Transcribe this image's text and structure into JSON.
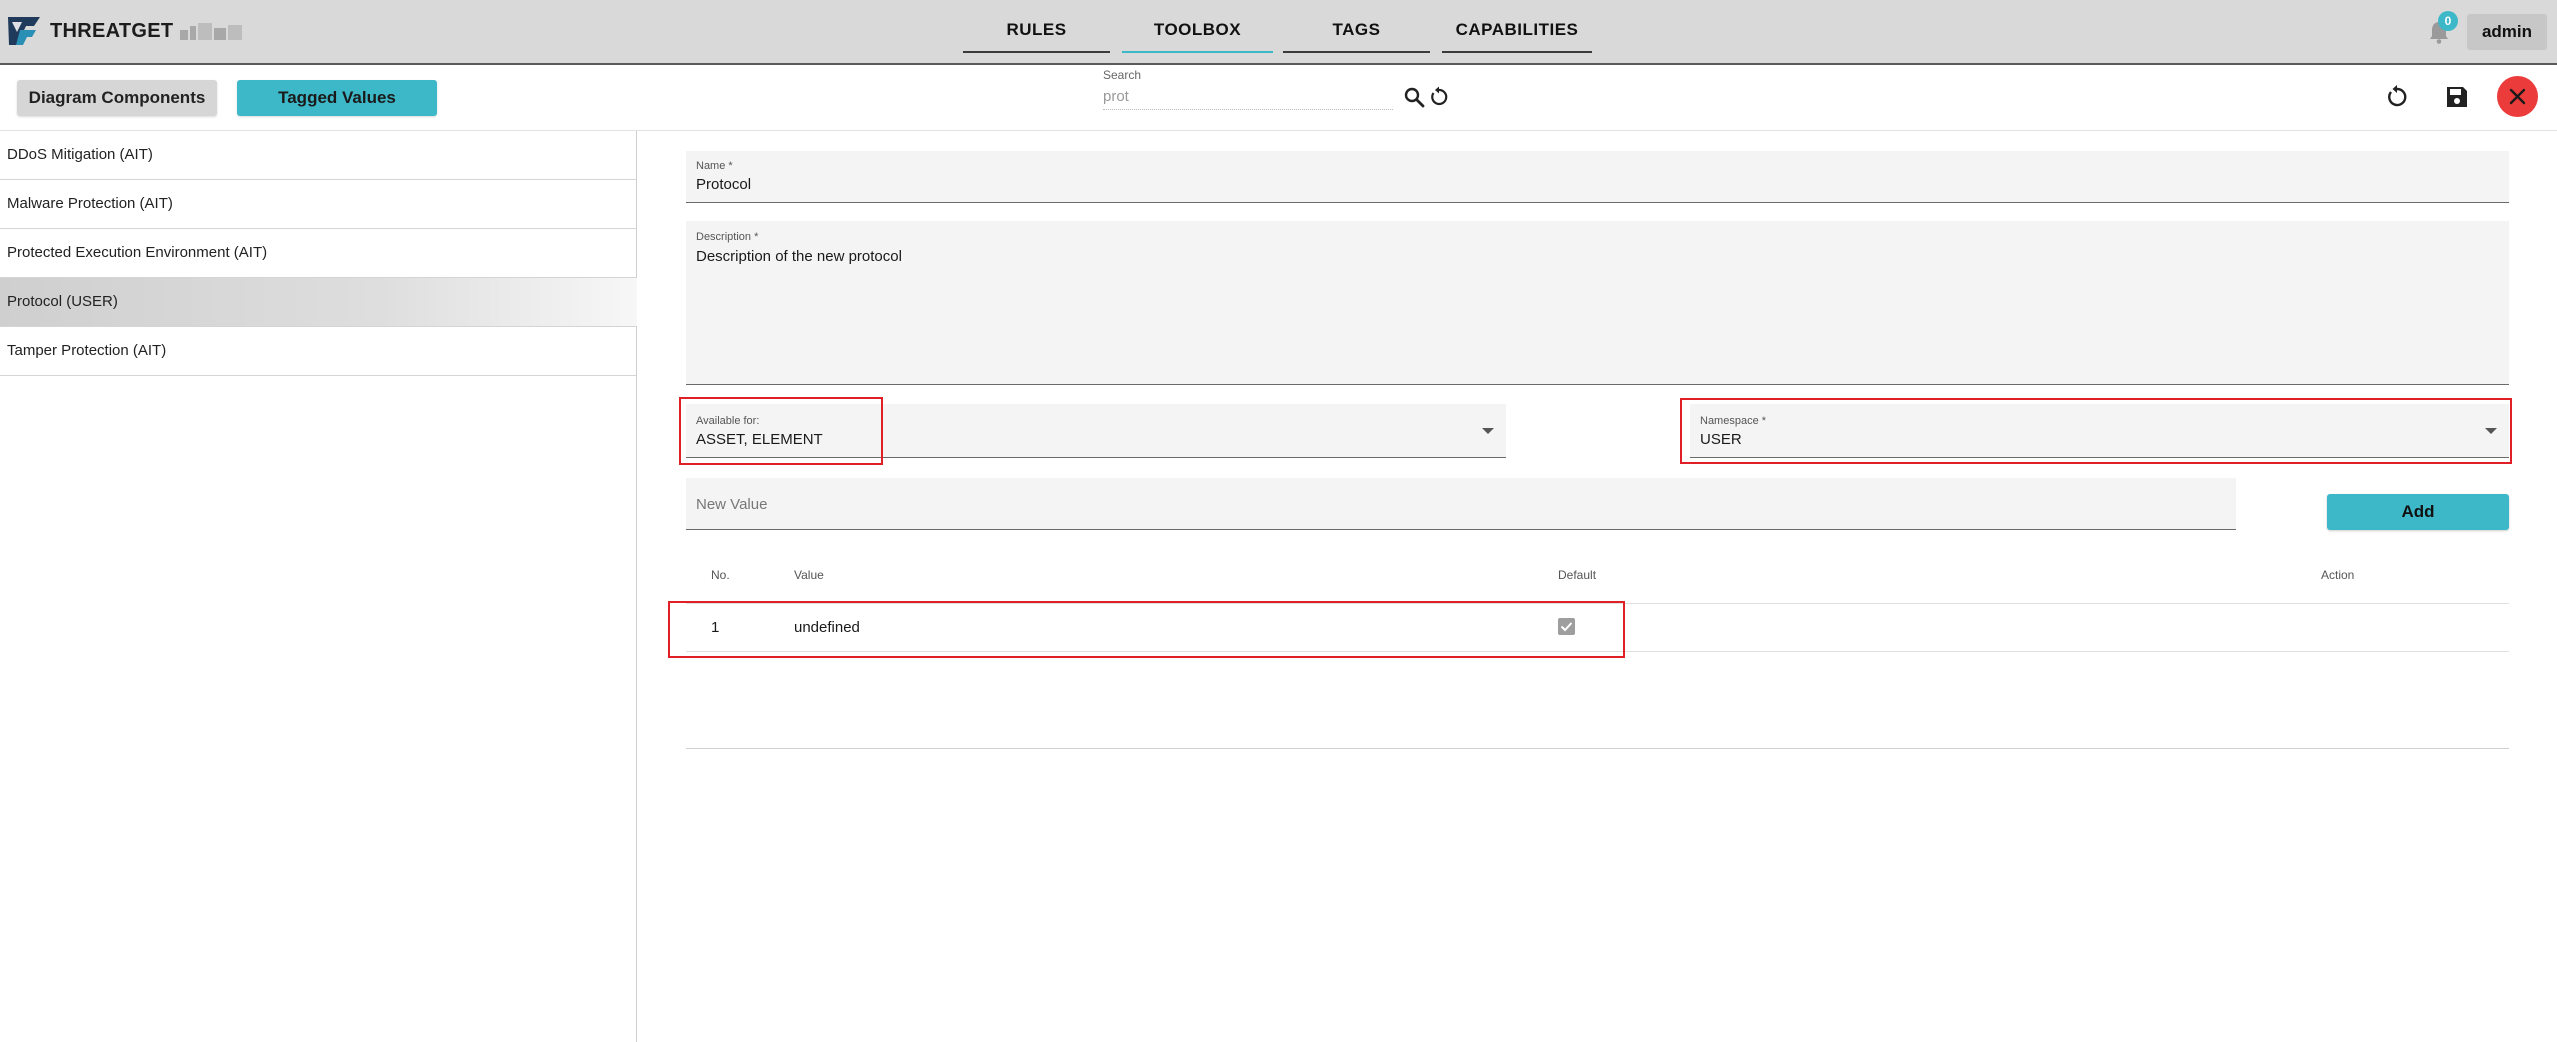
{
  "app": {
    "brand": "THREATGET"
  },
  "nav": {
    "tabs": [
      {
        "label": "RULES",
        "active": false
      },
      {
        "label": "TOOLBOX",
        "active": true
      },
      {
        "label": "TAGS",
        "active": false
      },
      {
        "label": "CAPABILITIES",
        "active": false
      }
    ],
    "notification_count": "0",
    "user": "admin"
  },
  "toolbar": {
    "diagram_components_label": "Diagram Components",
    "tagged_values_label": "Tagged Values",
    "search": {
      "label": "Search",
      "value": "prot"
    },
    "icons": [
      "search-icon",
      "reset-icon",
      "undo-icon",
      "save-icon",
      "close-icon"
    ]
  },
  "sidebar": {
    "items": [
      {
        "label": "DDoS Mitigation (AIT)",
        "selected": false
      },
      {
        "label": "Malware Protection (AIT)",
        "selected": false
      },
      {
        "label": "Protected Execution Environment (AIT)",
        "selected": false
      },
      {
        "label": "Protocol (USER)",
        "selected": true
      },
      {
        "label": "Tamper Protection (AIT)",
        "selected": false
      }
    ]
  },
  "form": {
    "name": {
      "label": "Name *",
      "value": "Protocol"
    },
    "description": {
      "label": "Description *",
      "value": "Description of the new protocol"
    },
    "available_for": {
      "label": "Available for:",
      "value": "ASSET, ELEMENT"
    },
    "namespace": {
      "label": "Namespace *",
      "value": "USER"
    },
    "new_value": {
      "placeholder": "New Value",
      "value": ""
    },
    "add_label": "Add"
  },
  "table": {
    "headers": {
      "no": "No.",
      "value": "Value",
      "default": "Default",
      "action": "Action"
    },
    "rows": [
      {
        "no": "1",
        "value": "undefined",
        "default": true
      }
    ]
  },
  "colors": {
    "accent": "#3db8c9",
    "close": "#ec3b3b",
    "highlight": "#e11f26",
    "topbar": "#d9d9d9"
  }
}
